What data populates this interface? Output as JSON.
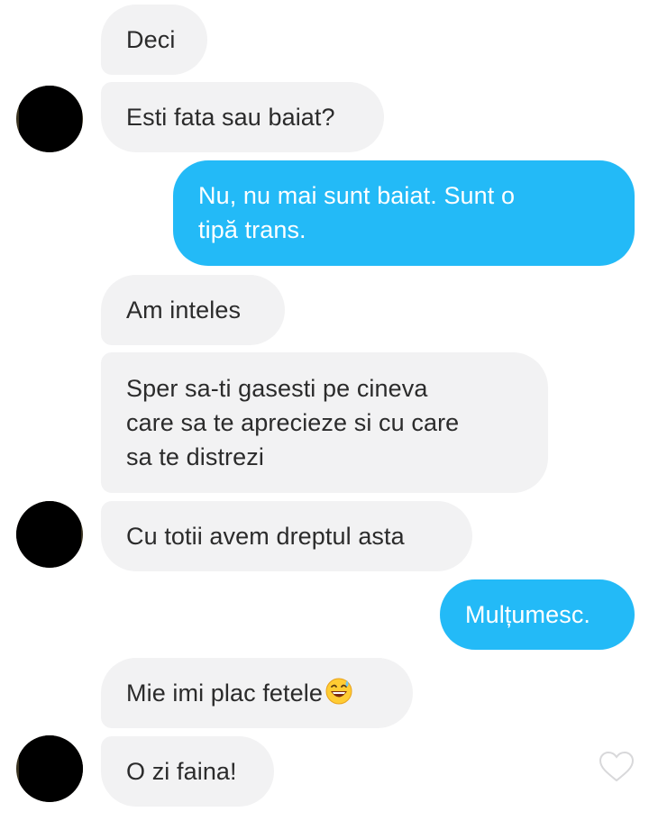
{
  "messages": [
    {
      "text": "Deci",
      "side": "incoming"
    },
    {
      "text": "Esti fata sau baiat?",
      "side": "incoming"
    },
    {
      "text": "Nu, nu mai sunt baiat. Sunt o tipă trans.",
      "line1": "Nu, nu mai sunt baiat. Sunt o",
      "line2": "tipă trans.",
      "side": "outgoing"
    },
    {
      "text": "Am inteles",
      "side": "incoming"
    },
    {
      "text": "Sper sa-ti gasesti pe cineva care sa te aprecieze si cu care sa te distrezi",
      "line1": "Sper sa-ti gasesti pe cineva",
      "line2": "care sa te aprecieze si cu care",
      "line3": "sa te distrezi",
      "side": "incoming"
    },
    {
      "text": "Cu totii avem dreptul asta",
      "side": "incoming"
    },
    {
      "text": "Mulțumesc.",
      "side": "outgoing"
    },
    {
      "text": "Mie imi plac fetele",
      "emoji": "grinning-sweat-emoji",
      "side": "incoming"
    },
    {
      "text": "O zi faina!",
      "side": "incoming"
    }
  ],
  "icons": {
    "like": "heart-outline-icon",
    "avatar": "contact-avatar (censored)"
  },
  "colors": {
    "incoming_bubble": "#f2f2f3",
    "outgoing_bubble": "#23baf7",
    "incoming_text": "#2b2b2b",
    "outgoing_text": "#ffffff",
    "heart_outline": "#d8d8da"
  }
}
